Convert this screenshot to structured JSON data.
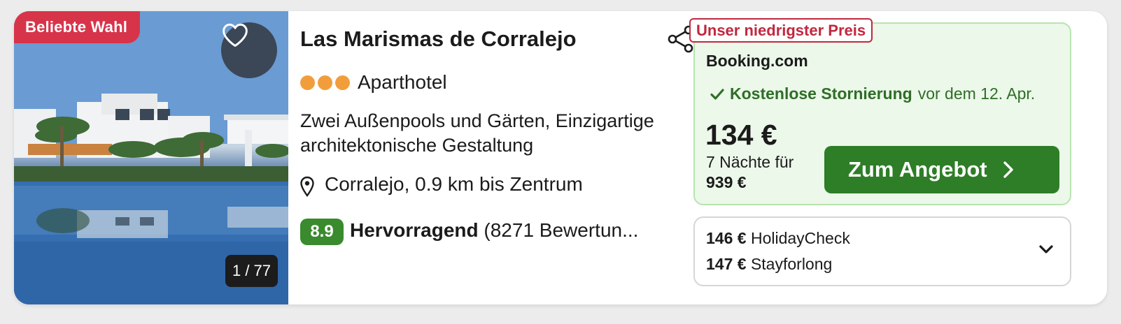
{
  "listing": {
    "badge": "Beliebte Wahl",
    "image_counter": "1 / 77",
    "name": "Las Marismas de Corralejo",
    "stars": 3,
    "type": "Aparthotel",
    "description": "Zwei Außenpools und Gärten, Einzigartige architektonische Gestaltung",
    "location": "Corralejo, 0.9 km bis Zentrum",
    "rating": {
      "score": "8.9",
      "label": "Hervorragend",
      "count": "(8271 Bewertun..."
    }
  },
  "best_offer": {
    "badge": "Unser niedrigster Preis",
    "provider": "Booking.com",
    "cancellation": "Kostenlose Stornierung",
    "cancellation_until": "vor dem 12. Apr.",
    "price": "134 €",
    "nights_label": "7 Nächte für",
    "total": "939 €",
    "cta_label": "Zum Angebot"
  },
  "other_offers": [
    {
      "price": "146 €",
      "provider": "HolidayCheck"
    },
    {
      "price": "147 €",
      "provider": "Stayforlong"
    }
  ],
  "icons": {
    "favorite": "heart-outline-icon",
    "share": "share-icon",
    "location": "map-pin-icon",
    "check": "checkmark-icon",
    "cta_arrow": "chevron-right-icon",
    "expand": "chevron-down-icon"
  },
  "colors": {
    "badge_red": "#d7344a",
    "star_orange": "#f29d3c",
    "rating_green": "#3a8a2e",
    "cta_green": "#2e7d27",
    "offer_bg": "#ecf8ea",
    "lowest_price_red": "#c1283f"
  }
}
